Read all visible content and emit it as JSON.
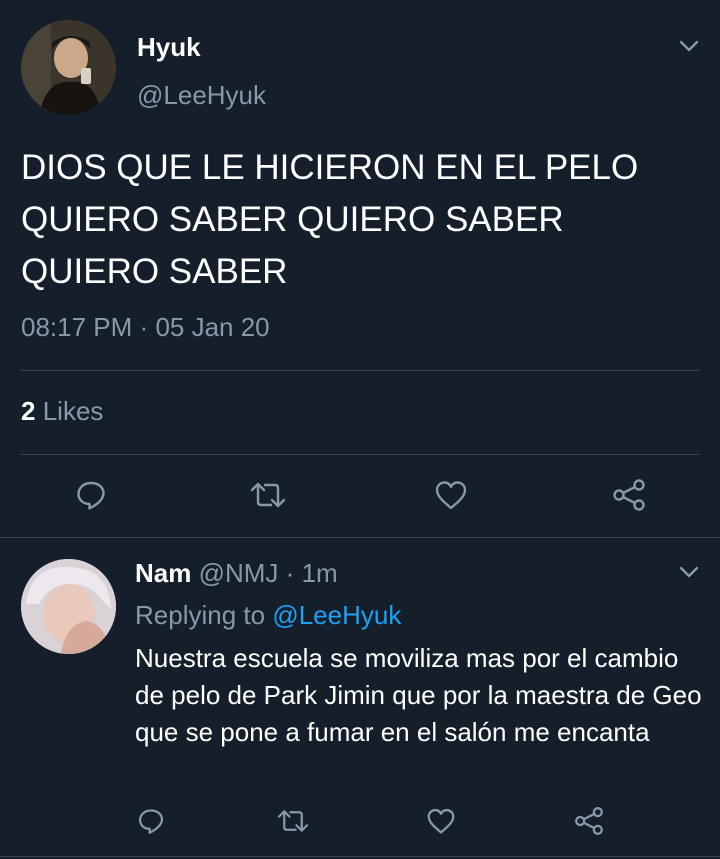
{
  "tweet": {
    "author_name": "Hyuk",
    "author_handle": "@LeeHyuk",
    "text": "DIOS QUE LE HICIERON EN EL PELO QUIERO SABER QUIERO SABER QUIERO SABER",
    "time": "08:17 PM",
    "date_separator": "·",
    "date": "05 Jan 20",
    "likes_count": "2",
    "likes_label": "Likes",
    "actions": [
      "reply-icon",
      "retweet-icon",
      "like-icon",
      "share-icon"
    ],
    "menu_icon": "chevron-down-icon"
  },
  "reply": {
    "author_name": "Nam",
    "author_handle": "@NMJ",
    "separator": "·",
    "time_ago": "1m",
    "replying_prefix": "Replying to",
    "replying_to": "@LeeHyuk",
    "text": "Nuestra escuela se moviliza mas por el cambio de pelo de Park Jimin que por la maestra de Geo que se pone a fumar en el salón me encanta",
    "actions": [
      "reply-icon",
      "retweet-icon",
      "like-icon",
      "share-icon"
    ],
    "menu_icon": "chevron-down-icon"
  },
  "colors": {
    "background": "#151f2b",
    "secondary_text": "#8899a6",
    "link": "#1da1f2",
    "divider": "#38444d"
  }
}
